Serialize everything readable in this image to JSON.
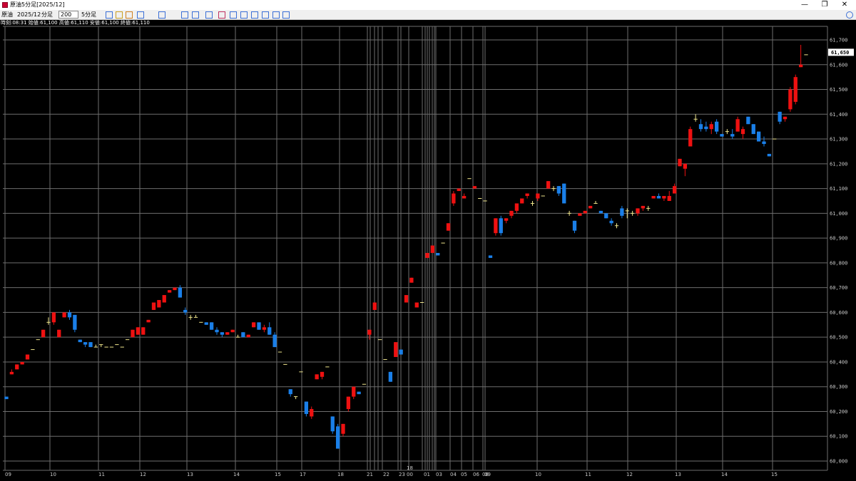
{
  "window": {
    "title": "原油5分足[2025/12]",
    "minimize": "—",
    "maximize": "❐",
    "close": "✕"
  },
  "toolbar": {
    "symbol": "原油",
    "contract": "2025/12",
    "period_unit": "分足",
    "bar_count": "200",
    "interval": "5分足",
    "icons": [
      "cursor-icon",
      "hand-icon",
      "pencil-icon",
      "line-icon",
      "circle-icon",
      "grid-icon",
      "table-icon",
      "bar-chart-icon",
      "x-icon",
      "chart-a-icon",
      "chart-b-icon",
      "chart-c-icon",
      "chart-d-icon",
      "chart-e-icon",
      "globe-icon"
    ],
    "settings_icon": "wrench-icon"
  },
  "info": "時刻:08:31 始値:61,100 高値:61,110 安値:61,100 終値:61,110",
  "colors": {
    "up": "#ee1111",
    "down": "#1a7fe8",
    "doji": "#f0e68c",
    "grid": "#6e6e6e",
    "background": "#000000",
    "price_tag_bg": "#ffffff"
  },
  "chart_data": {
    "type": "candlestick",
    "ylim": [
      60000,
      61750
    ],
    "yticks": [
      "61,700",
      "61,600",
      "61,500",
      "61,400",
      "61,300",
      "61,200",
      "61,100",
      "61,000",
      "60,900",
      "60,800",
      "60,700",
      "60,600",
      "60,500",
      "60,400",
      "60,300",
      "60,200",
      "60,100",
      "60,000"
    ],
    "last_price": "61,650",
    "day_labels": [
      "09",
      "10",
      "11",
      "12",
      "13",
      "14",
      "15",
      "17",
      "18",
      "18",
      "21",
      "22",
      "23",
      "00",
      "01",
      "03",
      "04",
      "05",
      "06",
      "08",
      "09",
      "10",
      "11",
      "12",
      "13",
      "14",
      "15"
    ],
    "candles": [
      [
        60260,
        60260,
        60250,
        60250
      ],
      [
        60350,
        60370,
        60350,
        60360
      ],
      [
        60370,
        60390,
        60370,
        60390
      ],
      [
        60390,
        60400,
        60390,
        60400
      ],
      [
        60410,
        60430,
        60410,
        60430
      ],
      [
        60450,
        60450,
        60450,
        60450
      ],
      [
        60490,
        60490,
        60490,
        60490
      ],
      [
        60500,
        60530,
        60500,
        60530
      ],
      [
        60560,
        60580,
        60550,
        60560
      ],
      [
        60560,
        60600,
        60550,
        60600
      ],
      [
        60500,
        60530,
        60500,
        60530
      ],
      [
        60580,
        60600,
        60580,
        60600
      ],
      [
        60600,
        60610,
        60570,
        60580
      ],
      [
        60590,
        60590,
        60520,
        60530
      ],
      [
        60490,
        60490,
        60480,
        60480
      ],
      [
        60480,
        60480,
        60460,
        60470
      ],
      [
        60480,
        60480,
        60460,
        60460
      ],
      [
        60460,
        60470,
        60460,
        60460
      ],
      [
        60470,
        60470,
        60460,
        60470
      ],
      [
        60460,
        60460,
        60460,
        60460
      ],
      [
        60460,
        60460,
        60460,
        60460
      ],
      [
        60470,
        60470,
        60470,
        60470
      ],
      [
        60460,
        60460,
        60460,
        60460
      ],
      [
        60490,
        60490,
        60490,
        60490
      ],
      [
        60500,
        60530,
        60500,
        60530
      ],
      [
        60510,
        60540,
        60510,
        60540
      ],
      [
        60510,
        60540,
        60510,
        60540
      ],
      [
        60560,
        60570,
        60560,
        60570
      ],
      [
        60610,
        60640,
        60610,
        60640
      ],
      [
        60620,
        60650,
        60620,
        60650
      ],
      [
        60640,
        60670,
        60640,
        60670
      ],
      [
        60680,
        60690,
        60680,
        60690
      ],
      [
        60690,
        60700,
        60690,
        60700
      ],
      [
        60700,
        60710,
        60660,
        60660
      ],
      [
        60610,
        60620,
        60590,
        60600
      ],
      [
        60580,
        60590,
        60570,
        60580
      ],
      [
        60580,
        60590,
        60580,
        60580
      ],
      [
        60560,
        60560,
        60560,
        60560
      ],
      [
        60560,
        60560,
        60550,
        60550
      ],
      [
        60560,
        60560,
        60530,
        60530
      ],
      [
        60530,
        60540,
        60510,
        60520
      ],
      [
        60520,
        60520,
        60500,
        60510
      ],
      [
        60510,
        60520,
        60510,
        60520
      ],
      [
        60520,
        60530,
        60520,
        60530
      ],
      [
        60500,
        60510,
        60500,
        60500
      ],
      [
        60520,
        60520,
        60500,
        60500
      ],
      [
        60500,
        60510,
        60500,
        60510
      ],
      [
        60540,
        60560,
        60540,
        60560
      ],
      [
        60560,
        60560,
        60530,
        60530
      ],
      [
        60530,
        60550,
        60520,
        60540
      ],
      [
        60540,
        60560,
        60510,
        60510
      ],
      [
        60510,
        60520,
        60460,
        60460
      ],
      [
        60440,
        60440,
        60440,
        60440
      ],
      [
        60390,
        60390,
        60390,
        60390
      ],
      [
        60290,
        60290,
        60260,
        60270
      ],
      [
        60260,
        60260,
        60250,
        60260
      ],
      [
        60360,
        60360,
        60360,
        60360
      ],
      [
        60240,
        60240,
        60180,
        60190
      ],
      [
        60180,
        60220,
        60170,
        60210
      ],
      [
        60330,
        60350,
        60330,
        60350
      ],
      [
        60340,
        60360,
        60330,
        60360
      ],
      [
        60380,
        60380,
        60380,
        60380
      ],
      [
        60180,
        60180,
        60110,
        60120
      ],
      [
        60140,
        60150,
        60080,
        60050
      ],
      [
        60110,
        60150,
        60100,
        60150
      ],
      [
        60210,
        60260,
        60200,
        60260
      ],
      [
        60260,
        60300,
        60250,
        60300
      ],
      [
        60280,
        60280,
        60270,
        60270
      ],
      [
        60310,
        60310,
        60310,
        60310
      ],
      [
        60510,
        60530,
        60490,
        60530
      ],
      [
        60610,
        60640,
        60610,
        60640
      ],
      [
        60490,
        60490,
        60490,
        60490
      ],
      [
        60410,
        60410,
        60410,
        60410
      ],
      [
        60360,
        60360,
        60320,
        60320
      ],
      [
        60420,
        60480,
        60420,
        60480
      ],
      [
        60450,
        60450,
        60430,
        60430
      ],
      [
        60640,
        60670,
        60640,
        60670
      ],
      [
        60720,
        60740,
        60720,
        60740
      ],
      [
        60620,
        60640,
        60620,
        60640
      ],
      [
        60640,
        60640,
        60640,
        60640
      ],
      [
        60820,
        60840,
        60820,
        60840
      ],
      [
        60840,
        60870,
        60840,
        60870
      ],
      [
        60840,
        60840,
        60830,
        60830
      ],
      [
        60880,
        60880,
        60880,
        60880
      ],
      [
        60930,
        60960,
        60930,
        60960
      ],
      [
        61040,
        61090,
        61030,
        61080
      ],
      [
        61090,
        61100,
        61090,
        61100
      ],
      [
        61060,
        61080,
        61060,
        61070
      ],
      [
        61140,
        61140,
        61140,
        61140
      ],
      [
        61100,
        61110,
        61100,
        61110
      ],
      [
        61060,
        61060,
        61060,
        61060
      ],
      [
        61050,
        61050,
        61050,
        61050
      ],
      [
        60830,
        60830,
        60820,
        60820
      ],
      [
        60920,
        60980,
        60910,
        60980
      ],
      [
        60980,
        60990,
        60910,
        60920
      ],
      [
        60970,
        60980,
        60960,
        60980
      ],
      [
        60990,
        61010,
        60980,
        61010
      ],
      [
        61010,
        61040,
        61000,
        61040
      ],
      [
        61040,
        61060,
        61040,
        61060
      ],
      [
        61070,
        61080,
        61060,
        61080
      ],
      [
        61040,
        61050,
        61030,
        61040
      ],
      [
        61060,
        61080,
        61050,
        61080
      ],
      [
        61070,
        61070,
        61070,
        61070
      ],
      [
        61100,
        61130,
        61100,
        61130
      ],
      [
        61100,
        61110,
        61090,
        61100
      ],
      [
        61110,
        61110,
        61070,
        61080
      ],
      [
        61120,
        61120,
        61040,
        61040
      ],
      [
        61000,
        61010,
        60990,
        61000
      ],
      [
        60970,
        60970,
        60920,
        60930
      ],
      [
        60990,
        61000,
        60990,
        61000
      ],
      [
        61000,
        61010,
        61000,
        61010
      ],
      [
        61020,
        61030,
        61020,
        61030
      ],
      [
        61040,
        61050,
        61040,
        61040
      ],
      [
        61010,
        61010,
        61000,
        61000
      ],
      [
        61000,
        61000,
        60980,
        60980
      ],
      [
        60970,
        60980,
        60950,
        60960
      ],
      [
        60950,
        60960,
        60940,
        60950
      ],
      [
        61020,
        61030,
        60980,
        60990
      ],
      [
        61010,
        61020,
        60980,
        61010
      ],
      [
        61000,
        61010,
        60990,
        61000
      ],
      [
        61000,
        61020,
        60990,
        61020
      ],
      [
        61020,
        61030,
        61010,
        61030
      ],
      [
        61020,
        61030,
        61010,
        61020
      ],
      [
        61060,
        61070,
        61060,
        61070
      ],
      [
        61070,
        61080,
        61060,
        61060
      ],
      [
        61060,
        61070,
        61050,
        61070
      ],
      [
        61050,
        61090,
        61050,
        61070
      ],
      [
        61080,
        61120,
        61080,
        61110
      ],
      [
        61190,
        61220,
        61190,
        61220
      ],
      [
        61180,
        61200,
        61150,
        61200
      ],
      [
        61270,
        61350,
        61270,
        61340
      ],
      [
        61380,
        61400,
        61370,
        61380
      ],
      [
        61360,
        61380,
        61330,
        61340
      ],
      [
        61350,
        61370,
        61330,
        61340
      ],
      [
        61340,
        61370,
        61320,
        61360
      ],
      [
        61370,
        61380,
        61320,
        61330
      ],
      [
        61320,
        61320,
        61310,
        61310
      ],
      [
        61330,
        61340,
        61320,
        61330
      ],
      [
        61320,
        61340,
        61300,
        61310
      ],
      [
        61330,
        61390,
        61330,
        61380
      ],
      [
        61320,
        61350,
        61300,
        61340
      ],
      [
        61390,
        61390,
        61360,
        61360
      ],
      [
        61360,
        61360,
        61320,
        61320
      ],
      [
        61330,
        61330,
        61290,
        61290
      ],
      [
        61290,
        61310,
        61270,
        61280
      ],
      [
        61240,
        61240,
        61230,
        61230
      ],
      [
        61300,
        61300,
        61300,
        61300
      ],
      [
        61410,
        61410,
        61360,
        61370
      ],
      [
        61380,
        61390,
        61370,
        61390
      ],
      [
        61420,
        61510,
        61410,
        61500
      ],
      [
        61450,
        61560,
        61440,
        61550
      ],
      [
        61590,
        61680,
        61590,
        61600
      ],
      [
        61640,
        61640,
        61640,
        61640
      ]
    ]
  }
}
